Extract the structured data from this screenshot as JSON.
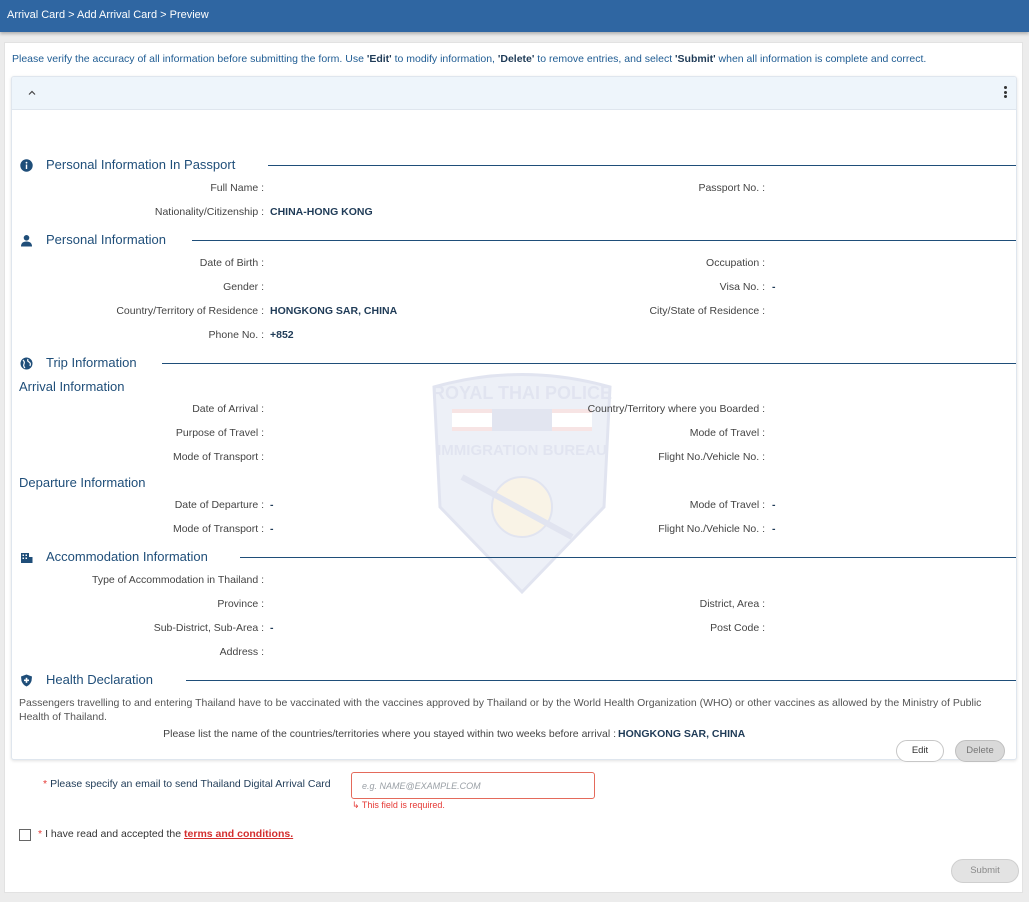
{
  "breadcrumb": "Arrival Card > Add Arrival Card > Preview",
  "notice": {
    "t1": "Please verify the accuracy of all information before submitting the form. Use ",
    "edit": "'Edit'",
    "t2": " to modify information, ",
    "delete": "'Delete'",
    "t3": " to remove entries, and select ",
    "submit": "'Submit'",
    "t4": " when all information is complete and correct."
  },
  "watermark": {
    "top": "ROYAL THAI POLICE",
    "mid": "IMMIGRATION BUREAU"
  },
  "sections": {
    "passport": {
      "title": "Personal Information In Passport",
      "full_name_label": "Full Name :",
      "full_name": "",
      "passport_label": "Passport No. :",
      "passport": "",
      "nationality_label": "Nationality/Citizenship :",
      "nationality": "CHINA-HONG KONG"
    },
    "personal": {
      "title": "Personal Information",
      "dob_label": "Date of Birth :",
      "dob": "",
      "occupation_label": "Occupation :",
      "occupation": "",
      "gender_label": "Gender :",
      "gender": "",
      "visa_label": "Visa No. :",
      "visa": "-",
      "residence_label": "Country/Territory of Residence :",
      "residence": "HONGKONG SAR, CHINA",
      "city_label": "City/State of Residence :",
      "city": "",
      "phone_label": "Phone No. :",
      "phone": "+852"
    },
    "trip": {
      "title": "Trip Information",
      "arrival_title": "Arrival Information",
      "arr_date_label": "Date of Arrival :",
      "arr_date": "",
      "boarded_label": "Country/Territory where you Boarded :",
      "boarded": "",
      "purpose_label": "Purpose of Travel :",
      "purpose": "",
      "arr_mode_travel_label": "Mode of Travel :",
      "arr_mode_travel": "",
      "arr_mode_transport_label": "Mode of Transport :",
      "arr_mode_transport": "",
      "arr_flight_label": "Flight No./Vehicle No. :",
      "arr_flight": "",
      "departure_title": "Departure Information",
      "dep_date_label": "Date of Departure :",
      "dep_date": "-",
      "dep_mode_travel_label": "Mode of Travel :",
      "dep_mode_travel": "-",
      "dep_mode_transport_label": "Mode of Transport :",
      "dep_mode_transport": "-",
      "dep_flight_label": "Flight No./Vehicle No. :",
      "dep_flight": "-"
    },
    "accommodation": {
      "title": "Accommodation Information",
      "type_label": "Type of Accommodation in Thailand :",
      "type": "",
      "province_label": "Province :",
      "province": "",
      "district_label": "District, Area :",
      "district": "",
      "subdistrict_label": "Sub-District, Sub-Area :",
      "subdistrict": "-",
      "postcode_label": "Post Code :",
      "postcode": "",
      "address_label": "Address :",
      "address": ""
    },
    "health": {
      "title": "Health Declaration",
      "text": "Passengers travelling to and entering Thailand have to be vaccinated with the vaccines approved by Thailand or by the World Health Organization (WHO) or other vaccines as allowed by the Ministry of Public Health of Thailand.",
      "countries_label": "Please list the name of the countries/territories where you stayed within two weeks before arrival :",
      "countries": "HONGKONG SAR, CHINA"
    }
  },
  "buttons": {
    "edit": "Edit",
    "delete": "Delete",
    "submit": "Submit"
  },
  "email": {
    "required_mark": "*",
    "label": "Please specify an email to send Thailand Digital Arrival Card",
    "placeholder": "e.g. NAME@EXAMPLE.COM",
    "value": "",
    "error": "↳ This field is required."
  },
  "terms": {
    "required_mark": "*",
    "text": "I have read and accepted the ",
    "link": "terms and conditions."
  },
  "colors": {
    "header": "#2f66a2",
    "section": "#1f4e79",
    "error": "#e53935"
  }
}
